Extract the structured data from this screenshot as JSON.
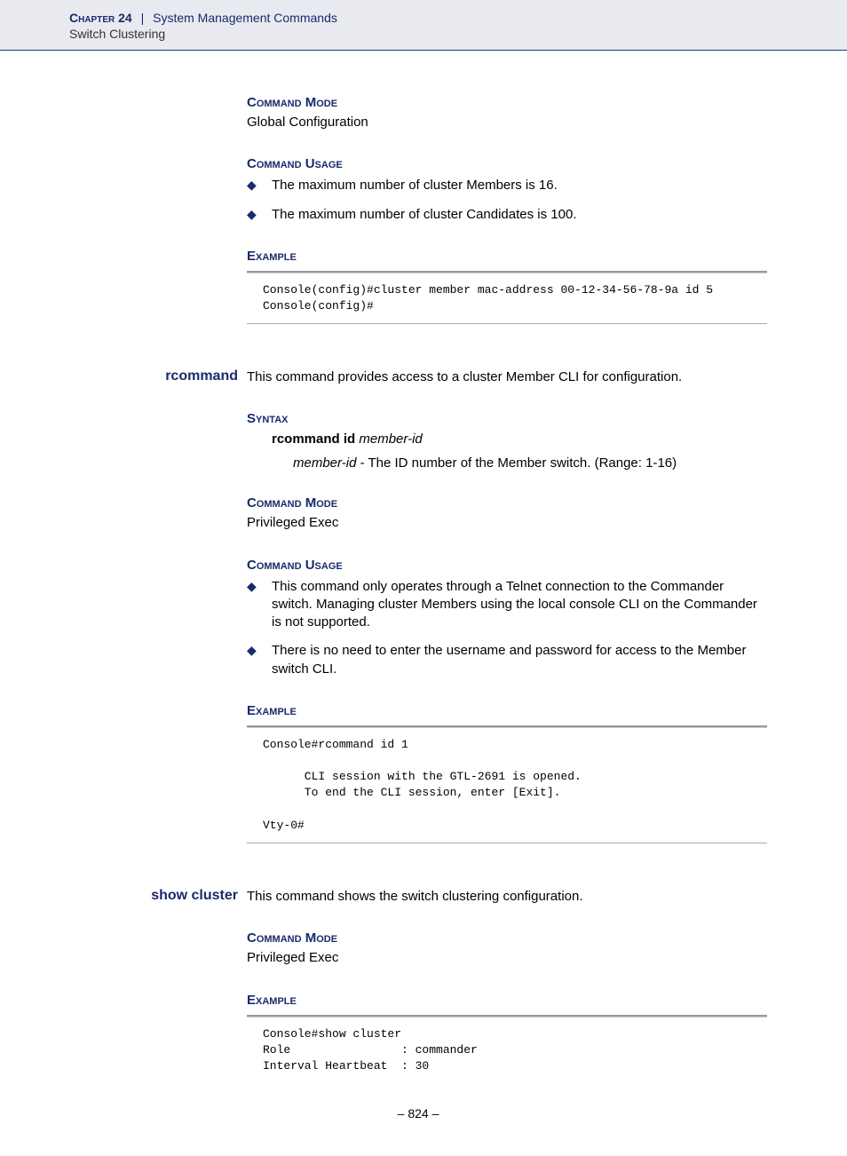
{
  "header": {
    "chapter_label": "Chapter 24",
    "divider": "|",
    "section": "System Management Commands",
    "subsection": "Switch Clustering"
  },
  "block1": {
    "cmd_mode_h": "Command Mode",
    "cmd_mode_v": "Global Configuration",
    "cmd_usage_h": "Command Usage",
    "bullet1": "The maximum number of cluster Members is 16.",
    "bullet2": "The maximum number of cluster Candidates is 100.",
    "example_h": "Example",
    "code": "Console(config)#cluster member mac-address 00-12-34-56-78-9a id 5\nConsole(config)#"
  },
  "rcommand": {
    "name": "rcommand",
    "desc": "This command provides access to a cluster Member CLI for configuration.",
    "syntax_h": "Syntax",
    "syntax_cmd": "rcommand id",
    "syntax_param": "member-id",
    "syntax_sub_param": "member-id",
    "syntax_sub_text": " - The ID number of the Member switch. (Range: 1-16)",
    "cmd_mode_h": "Command Mode",
    "cmd_mode_v": "Privileged Exec",
    "cmd_usage_h": "Command Usage",
    "bullet1": "This command only operates through a Telnet connection to the Commander switch. Managing cluster Members using the local console CLI on the Commander is not supported.",
    "bullet2": "There is no need to enter the username and password for access to the Member switch CLI.",
    "example_h": "Example",
    "code": "Console#rcommand id 1\n\n      CLI session with the GTL-2691 is opened.\n      To end the CLI session, enter [Exit].\n\nVty-0#"
  },
  "showcluster": {
    "name": "show cluster",
    "desc": "This command shows the switch clustering configuration.",
    "cmd_mode_h": "Command Mode",
    "cmd_mode_v": "Privileged Exec",
    "example_h": "Example",
    "code": "Console#show cluster\nRole                : commander\nInterval Heartbeat  : 30"
  },
  "page_number": "– 824 –"
}
